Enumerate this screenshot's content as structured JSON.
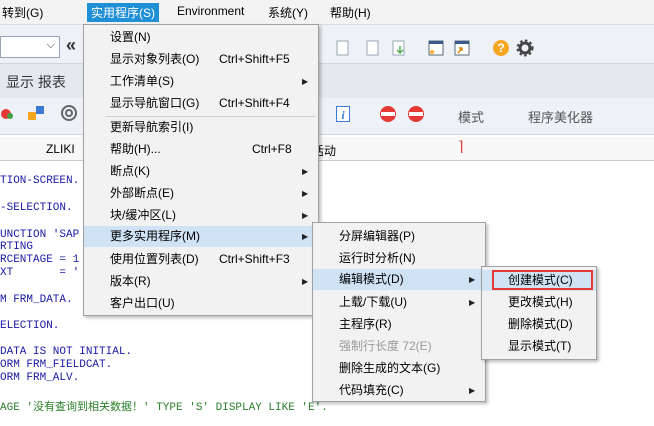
{
  "menubar": {
    "items": [
      {
        "label": "转到(G)"
      },
      {
        "label": "实用程序(S)",
        "active": true
      },
      {
        "label": "Environment"
      },
      {
        "label": "系统(Y)"
      },
      {
        "label": "帮助(H)"
      }
    ]
  },
  "toolbar2": {
    "display_label": "显示 报表"
  },
  "toolbar3": {
    "mode_label": "模式",
    "pretty_printer_label": "程序美化器"
  },
  "program_line": {
    "program_fragment": "ZLIKI",
    "activity_fragment": "活动"
  },
  "code_lines": [
    {
      "text": "TION-SCREEN.",
      "color": "#1a1aa6"
    },
    {
      "text": "-SELECTION.",
      "color": "#1a1aa6"
    },
    {
      "text": "UNCTION 'SAP",
      "color": "#1a1aa6"
    },
    {
      "text": "RTING",
      "color": "#1a1aa6"
    },
    {
      "text": "RCENTAGE = 1",
      "color": "#1a1aa6"
    },
    {
      "text": "XT       = '",
      "color": "#1a1aa6"
    },
    {
      "text": "M FRM_DATA.",
      "color": "#1a1aa6"
    },
    {
      "text": "ELECTION.",
      "color": "#1a1aa6"
    },
    {
      "text": "DATA IS NOT INITIAL.",
      "color": "#1a1aa6"
    },
    {
      "text": "ORM FRM_FIELDCAT.",
      "color": "#1a1aa6"
    },
    {
      "text": "ORM FRM_ALV.",
      "color": "#1a1aa6"
    },
    {
      "text": "AGE '没有查询到相关数据！' TYPE 'S' DISPLAY LIKE 'E'.",
      "color": "#2a7f2a"
    }
  ],
  "utilities_menu": {
    "items": [
      {
        "label": "设置(N)",
        "shortcut": "",
        "submenu": false
      },
      {
        "label": "显示对象列表(O)",
        "shortcut": "Ctrl+Shift+F5",
        "submenu": false
      },
      {
        "label": "工作清单(S)",
        "shortcut": "",
        "submenu": true
      },
      {
        "label": "显示导航窗口(G)",
        "shortcut": "Ctrl+Shift+F4",
        "submenu": false
      },
      {
        "label": "更新导航索引(I)",
        "shortcut": "",
        "submenu": false
      },
      {
        "label": "帮助(H)...",
        "shortcut": "Ctrl+F8",
        "submenu": false
      },
      {
        "label": "断点(K)",
        "shortcut": "",
        "submenu": true
      },
      {
        "label": "外部断点(E)",
        "shortcut": "",
        "submenu": true
      },
      {
        "label": "块/缓冲区(L)",
        "shortcut": "",
        "submenu": true
      },
      {
        "label": "更多实用程序(M)",
        "shortcut": "",
        "submenu": true,
        "highlighted": true
      },
      {
        "label": "使用位置列表(D)",
        "shortcut": "Ctrl+Shift+F3",
        "submenu": false
      },
      {
        "label": "版本(R)",
        "shortcut": "",
        "submenu": true
      },
      {
        "label": "客户出口(U)",
        "shortcut": "",
        "submenu": false
      }
    ]
  },
  "more_utilities_menu": {
    "items": [
      {
        "label": "分屏编辑器(P)",
        "submenu": false
      },
      {
        "label": "运行时分析(N)",
        "submenu": false
      },
      {
        "label": "编辑模式(D)",
        "submenu": true,
        "highlighted": true
      },
      {
        "label": "上载/下载(U)",
        "submenu": true
      },
      {
        "label": "主程序(R)",
        "submenu": false
      },
      {
        "label": "强制行长度 72(E)",
        "submenu": false,
        "disabled": true
      },
      {
        "label": "删除生成的文本(G)",
        "submenu": false
      },
      {
        "label": "代码填充(C)",
        "submenu": true
      }
    ]
  },
  "edit_mode_menu": {
    "items": [
      {
        "label": "创建模式(C)",
        "highlighted": true
      },
      {
        "label": "更改模式(H)"
      },
      {
        "label": "删除模式(D)"
      },
      {
        "label": "显示模式(T)"
      }
    ]
  },
  "colors": {
    "menubar_active": "#1f8fd6",
    "highlight": "#cfe3f5",
    "focus_border": "#e53935"
  }
}
